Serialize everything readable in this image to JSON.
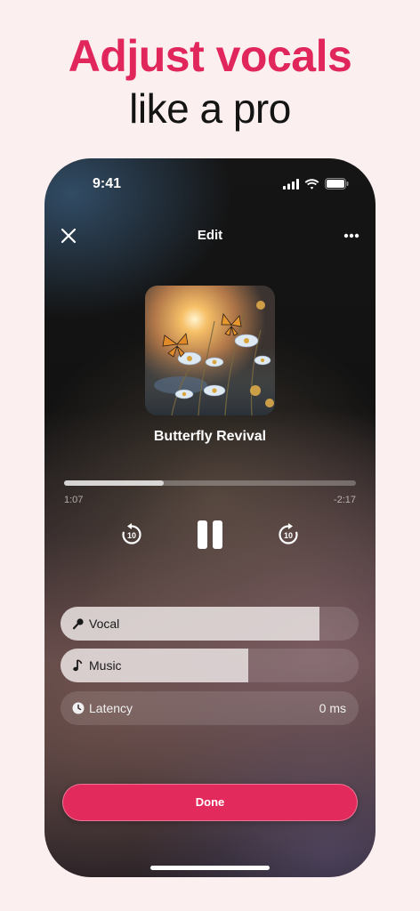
{
  "headline": {
    "line1": "Adjust vocals",
    "line2": "like a pro"
  },
  "colors": {
    "accent": "#e0265a",
    "button": "#e32a5c",
    "background": "#fcefef"
  },
  "status_bar": {
    "time": "9:41",
    "icons": [
      "signal-icon",
      "wifi-icon",
      "battery-icon"
    ]
  },
  "top_bar": {
    "title": "Edit",
    "left_icon": "close-icon",
    "right_icon": "more-icon"
  },
  "track": {
    "title": "Butterfly Revival"
  },
  "playback": {
    "elapsed": "1:07",
    "remaining": "-2:17",
    "progress": 0.34,
    "skip_back_icon": "rewind-10-icon",
    "skip_forward_icon": "forward-10-icon",
    "state_icon": "pause-icon"
  },
  "sliders": {
    "vocal": {
      "label": "Vocal",
      "level": 0.87,
      "icon": "microphone-icon"
    },
    "music": {
      "label": "Music",
      "level": 0.63,
      "icon": "music-note-icon"
    },
    "latency": {
      "label": "Latency",
      "value": "0 ms",
      "icon": "clock-icon"
    }
  },
  "done_button": {
    "label": "Done"
  }
}
